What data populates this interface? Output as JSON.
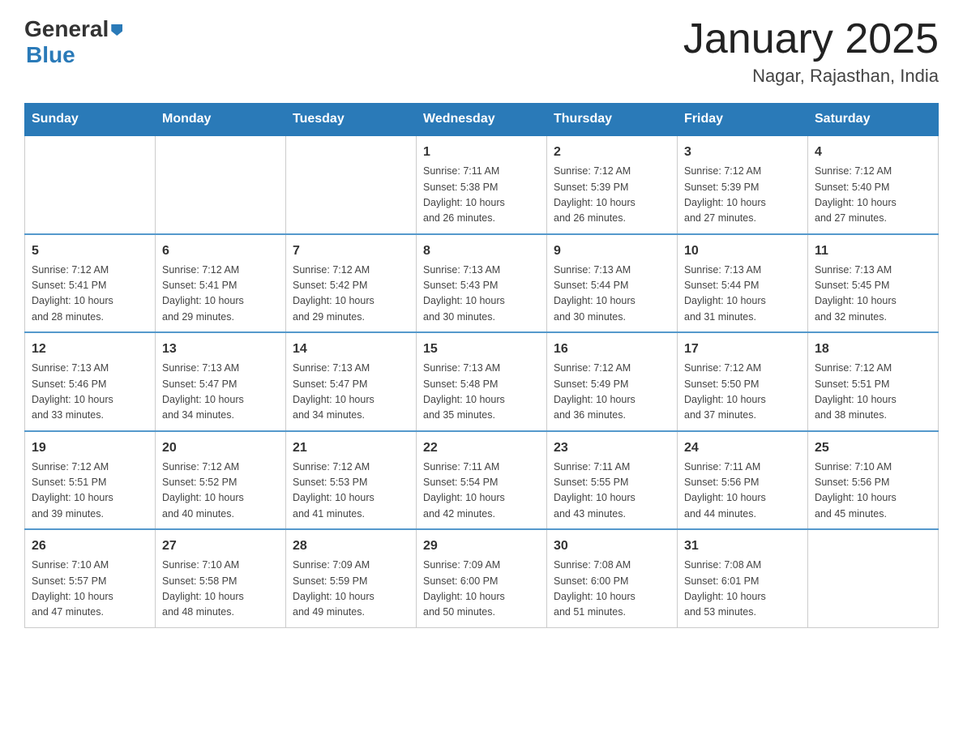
{
  "header": {
    "logo": {
      "general": "General",
      "arrow": "▶",
      "blue": "Blue"
    },
    "title": "January 2025",
    "location": "Nagar, Rajasthan, India"
  },
  "calendar": {
    "days_of_week": [
      "Sunday",
      "Monday",
      "Tuesday",
      "Wednesday",
      "Thursday",
      "Friday",
      "Saturday"
    ],
    "weeks": [
      [
        {
          "day": "",
          "info": ""
        },
        {
          "day": "",
          "info": ""
        },
        {
          "day": "",
          "info": ""
        },
        {
          "day": "1",
          "info": "Sunrise: 7:11 AM\nSunset: 5:38 PM\nDaylight: 10 hours\nand 26 minutes."
        },
        {
          "day": "2",
          "info": "Sunrise: 7:12 AM\nSunset: 5:39 PM\nDaylight: 10 hours\nand 26 minutes."
        },
        {
          "day": "3",
          "info": "Sunrise: 7:12 AM\nSunset: 5:39 PM\nDaylight: 10 hours\nand 27 minutes."
        },
        {
          "day": "4",
          "info": "Sunrise: 7:12 AM\nSunset: 5:40 PM\nDaylight: 10 hours\nand 27 minutes."
        }
      ],
      [
        {
          "day": "5",
          "info": "Sunrise: 7:12 AM\nSunset: 5:41 PM\nDaylight: 10 hours\nand 28 minutes."
        },
        {
          "day": "6",
          "info": "Sunrise: 7:12 AM\nSunset: 5:41 PM\nDaylight: 10 hours\nand 29 minutes."
        },
        {
          "day": "7",
          "info": "Sunrise: 7:12 AM\nSunset: 5:42 PM\nDaylight: 10 hours\nand 29 minutes."
        },
        {
          "day": "8",
          "info": "Sunrise: 7:13 AM\nSunset: 5:43 PM\nDaylight: 10 hours\nand 30 minutes."
        },
        {
          "day": "9",
          "info": "Sunrise: 7:13 AM\nSunset: 5:44 PM\nDaylight: 10 hours\nand 30 minutes."
        },
        {
          "day": "10",
          "info": "Sunrise: 7:13 AM\nSunset: 5:44 PM\nDaylight: 10 hours\nand 31 minutes."
        },
        {
          "day": "11",
          "info": "Sunrise: 7:13 AM\nSunset: 5:45 PM\nDaylight: 10 hours\nand 32 minutes."
        }
      ],
      [
        {
          "day": "12",
          "info": "Sunrise: 7:13 AM\nSunset: 5:46 PM\nDaylight: 10 hours\nand 33 minutes."
        },
        {
          "day": "13",
          "info": "Sunrise: 7:13 AM\nSunset: 5:47 PM\nDaylight: 10 hours\nand 34 minutes."
        },
        {
          "day": "14",
          "info": "Sunrise: 7:13 AM\nSunset: 5:47 PM\nDaylight: 10 hours\nand 34 minutes."
        },
        {
          "day": "15",
          "info": "Sunrise: 7:13 AM\nSunset: 5:48 PM\nDaylight: 10 hours\nand 35 minutes."
        },
        {
          "day": "16",
          "info": "Sunrise: 7:12 AM\nSunset: 5:49 PM\nDaylight: 10 hours\nand 36 minutes."
        },
        {
          "day": "17",
          "info": "Sunrise: 7:12 AM\nSunset: 5:50 PM\nDaylight: 10 hours\nand 37 minutes."
        },
        {
          "day": "18",
          "info": "Sunrise: 7:12 AM\nSunset: 5:51 PM\nDaylight: 10 hours\nand 38 minutes."
        }
      ],
      [
        {
          "day": "19",
          "info": "Sunrise: 7:12 AM\nSunset: 5:51 PM\nDaylight: 10 hours\nand 39 minutes."
        },
        {
          "day": "20",
          "info": "Sunrise: 7:12 AM\nSunset: 5:52 PM\nDaylight: 10 hours\nand 40 minutes."
        },
        {
          "day": "21",
          "info": "Sunrise: 7:12 AM\nSunset: 5:53 PM\nDaylight: 10 hours\nand 41 minutes."
        },
        {
          "day": "22",
          "info": "Sunrise: 7:11 AM\nSunset: 5:54 PM\nDaylight: 10 hours\nand 42 minutes."
        },
        {
          "day": "23",
          "info": "Sunrise: 7:11 AM\nSunset: 5:55 PM\nDaylight: 10 hours\nand 43 minutes."
        },
        {
          "day": "24",
          "info": "Sunrise: 7:11 AM\nSunset: 5:56 PM\nDaylight: 10 hours\nand 44 minutes."
        },
        {
          "day": "25",
          "info": "Sunrise: 7:10 AM\nSunset: 5:56 PM\nDaylight: 10 hours\nand 45 minutes."
        }
      ],
      [
        {
          "day": "26",
          "info": "Sunrise: 7:10 AM\nSunset: 5:57 PM\nDaylight: 10 hours\nand 47 minutes."
        },
        {
          "day": "27",
          "info": "Sunrise: 7:10 AM\nSunset: 5:58 PM\nDaylight: 10 hours\nand 48 minutes."
        },
        {
          "day": "28",
          "info": "Sunrise: 7:09 AM\nSunset: 5:59 PM\nDaylight: 10 hours\nand 49 minutes."
        },
        {
          "day": "29",
          "info": "Sunrise: 7:09 AM\nSunset: 6:00 PM\nDaylight: 10 hours\nand 50 minutes."
        },
        {
          "day": "30",
          "info": "Sunrise: 7:08 AM\nSunset: 6:00 PM\nDaylight: 10 hours\nand 51 minutes."
        },
        {
          "day": "31",
          "info": "Sunrise: 7:08 AM\nSunset: 6:01 PM\nDaylight: 10 hours\nand 53 minutes."
        },
        {
          "day": "",
          "info": ""
        }
      ]
    ]
  }
}
